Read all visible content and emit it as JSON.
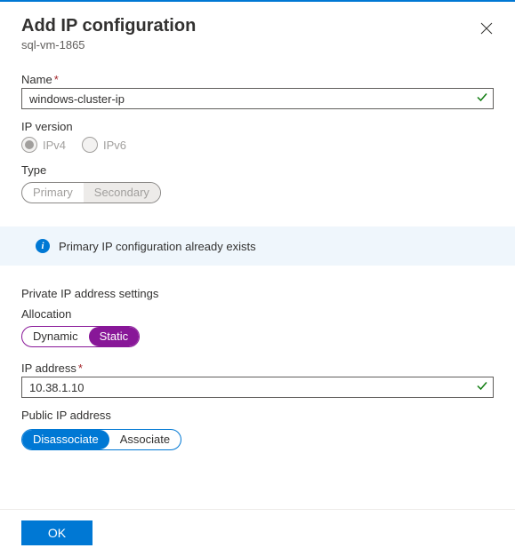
{
  "header": {
    "title": "Add IP configuration",
    "subtitle": "sql-vm-1865"
  },
  "fields": {
    "name_label": "Name",
    "name_value": "windows-cluster-ip",
    "ipversion_label": "IP version",
    "ipv4": "IPv4",
    "ipv6": "IPv6",
    "type_label": "Type",
    "type_primary": "Primary",
    "type_secondary": "Secondary"
  },
  "info": {
    "message": "Primary IP configuration already exists"
  },
  "private": {
    "heading": "Private IP address settings",
    "allocation_label": "Allocation",
    "dynamic": "Dynamic",
    "static": "Static",
    "ipaddress_label": "IP address",
    "ipaddress_value": "10.38.1.10"
  },
  "public": {
    "heading": "Public IP address",
    "disassociate": "Disassociate",
    "associate": "Associate"
  },
  "footer": {
    "ok": "OK"
  }
}
